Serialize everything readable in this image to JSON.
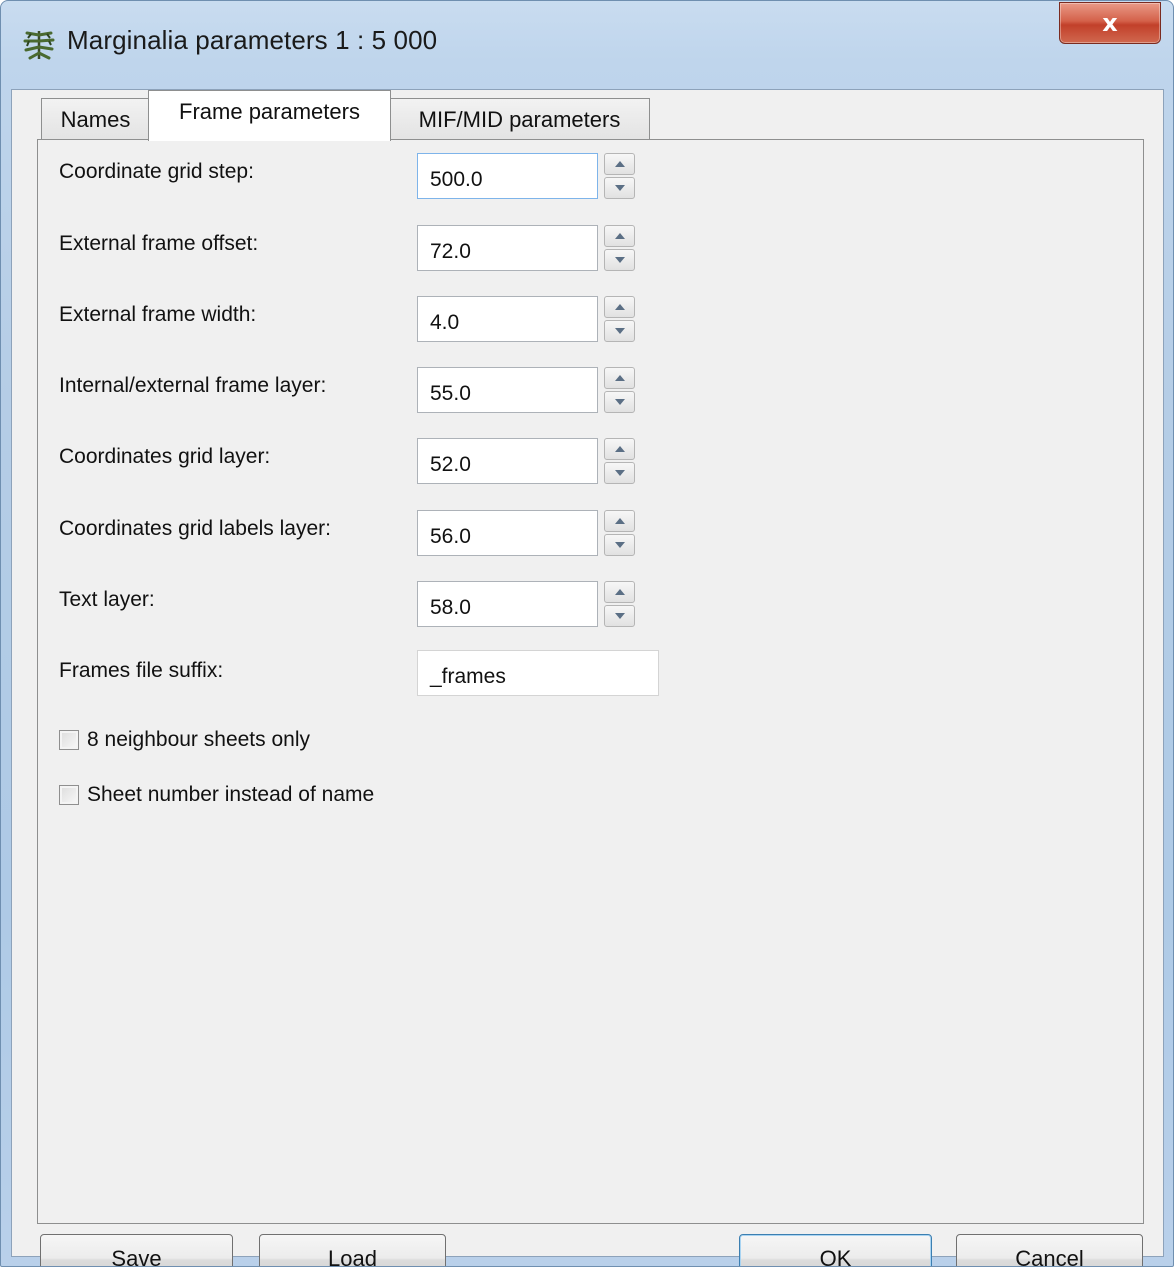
{
  "window": {
    "title": "Marginalia parameters 1 : 5 000",
    "close_label": "x"
  },
  "tabs": [
    {
      "label": "Names",
      "active": false
    },
    {
      "label": "Frame parameters",
      "active": true
    },
    {
      "label": "MIF/MID parameters",
      "active": false
    }
  ],
  "fields": [
    {
      "label": "Coordinate grid step:",
      "value": "500.0"
    },
    {
      "label": "External frame offset:",
      "value": "72.0"
    },
    {
      "label": "External frame width:",
      "value": "4.0"
    },
    {
      "label": "Internal/external frame layer:",
      "value": "55.0"
    },
    {
      "label": "Coordinates grid layer:",
      "value": "52.0"
    },
    {
      "label": "Coordinates grid labels layer:",
      "value": "56.0"
    },
    {
      "label": "Text layer:",
      "value": "58.0"
    }
  ],
  "suffix": {
    "label": "Frames file suffix:",
    "value": "_frames"
  },
  "checkboxes": [
    {
      "label": "8 neighbour sheets only",
      "checked": false
    },
    {
      "label": "Sheet number instead of name",
      "checked": false
    }
  ],
  "buttons": {
    "save": "Save",
    "load": "Load",
    "ok": "OK",
    "cancel": "Cancel"
  },
  "icons": {
    "app": "spruce-branch-icon",
    "close": "close-icon",
    "spin_up": "arrow-up-icon",
    "spin_down": "arrow-down-icon"
  }
}
